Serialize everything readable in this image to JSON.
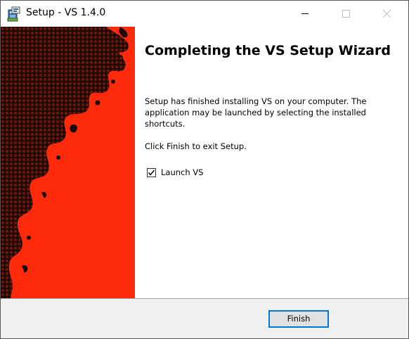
{
  "window": {
    "title": "Setup - VS 1.4.0",
    "controls": {
      "minimize_icon": "minimize-icon",
      "maximize_icon": "maximize-icon",
      "close_icon": "close-icon"
    }
  },
  "banner": {
    "background_color": "#ff2a0c",
    "art_color": "#1a0a06"
  },
  "content": {
    "heading": "Completing the VS Setup Wizard",
    "paragraph": "Setup has finished installing VS on your computer. The application may be launched by selecting the installed shortcuts.",
    "instruction": "Click Finish to exit Setup.",
    "launch_checkbox": {
      "label": "Launch VS",
      "checked": true
    }
  },
  "footer": {
    "finish_label": "Finish",
    "accent_color": "#0078d7"
  }
}
